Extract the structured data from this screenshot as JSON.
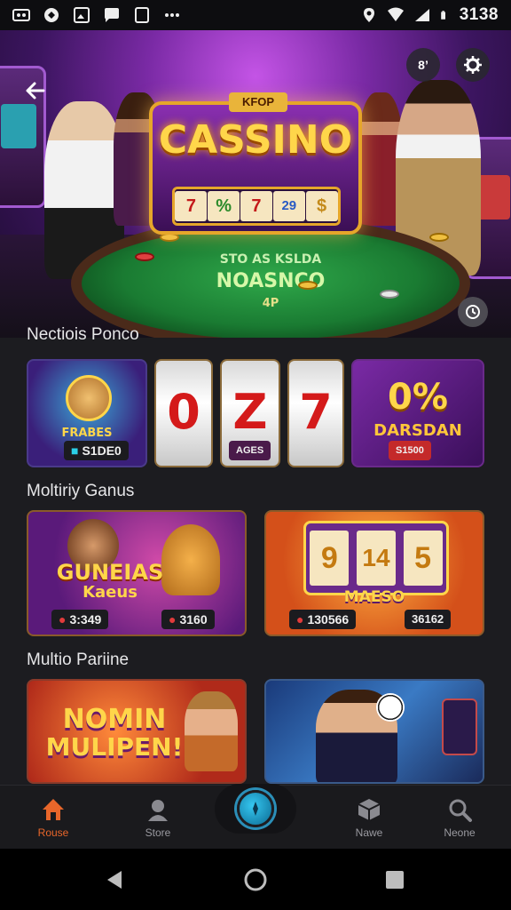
{
  "status_bar": {
    "left_icons": [
      "voicemail-icon",
      "chat-icon",
      "image-icon",
      "message-icon",
      "square-icon",
      "more-dots-icon"
    ],
    "clock": "3138"
  },
  "hero": {
    "sign_top": "KFOP",
    "sign_title": "CASSINO",
    "reels": [
      "7",
      "%",
      "7",
      "29",
      "$"
    ],
    "table_line1": "STO AS KSLDA",
    "table_line2": "NOASNCO",
    "table_line3": "4P",
    "badge_label": "8’"
  },
  "sections": [
    {
      "title": "Nectiois Ponco"
    },
    {
      "title": "Moltiriy Ganus"
    },
    {
      "title": "Multio Pariine"
    }
  ],
  "row1": {
    "card1_banner": "FRABES",
    "card1_price": "S1DE0",
    "reel_digits": [
      "0",
      "Z",
      "7"
    ],
    "reel_price_2": "AGES",
    "card5_big": "0%",
    "card5_caption": "DARSDAN",
    "card5_price": "S1500"
  },
  "row2": {
    "card1_title_a": "GUNEIAS",
    "card1_title_b": "Kaeus",
    "card1_price_left": "3:349",
    "card1_price_right": "3160",
    "card2_reels": [
      "9",
      "14",
      "5"
    ],
    "card2_banner": "MAESO",
    "card2_price_left": "130566",
    "card2_price_right": "36162"
  },
  "row3": {
    "card1_title_a": "NOMIN",
    "card1_title_b": "MULIPEN!"
  },
  "bottom_nav": {
    "items": [
      {
        "label": "Rouse",
        "icon": "home-icon"
      },
      {
        "label": "Store",
        "icon": "profile-icon"
      },
      {
        "label": "Nawe",
        "icon": "cube-icon"
      },
      {
        "label": "Neone",
        "icon": "search-icon"
      }
    ]
  },
  "colors": {
    "active_nav": "#e8662a",
    "accent_blue": "#2bb4e6",
    "gold": "#ffd64a"
  }
}
